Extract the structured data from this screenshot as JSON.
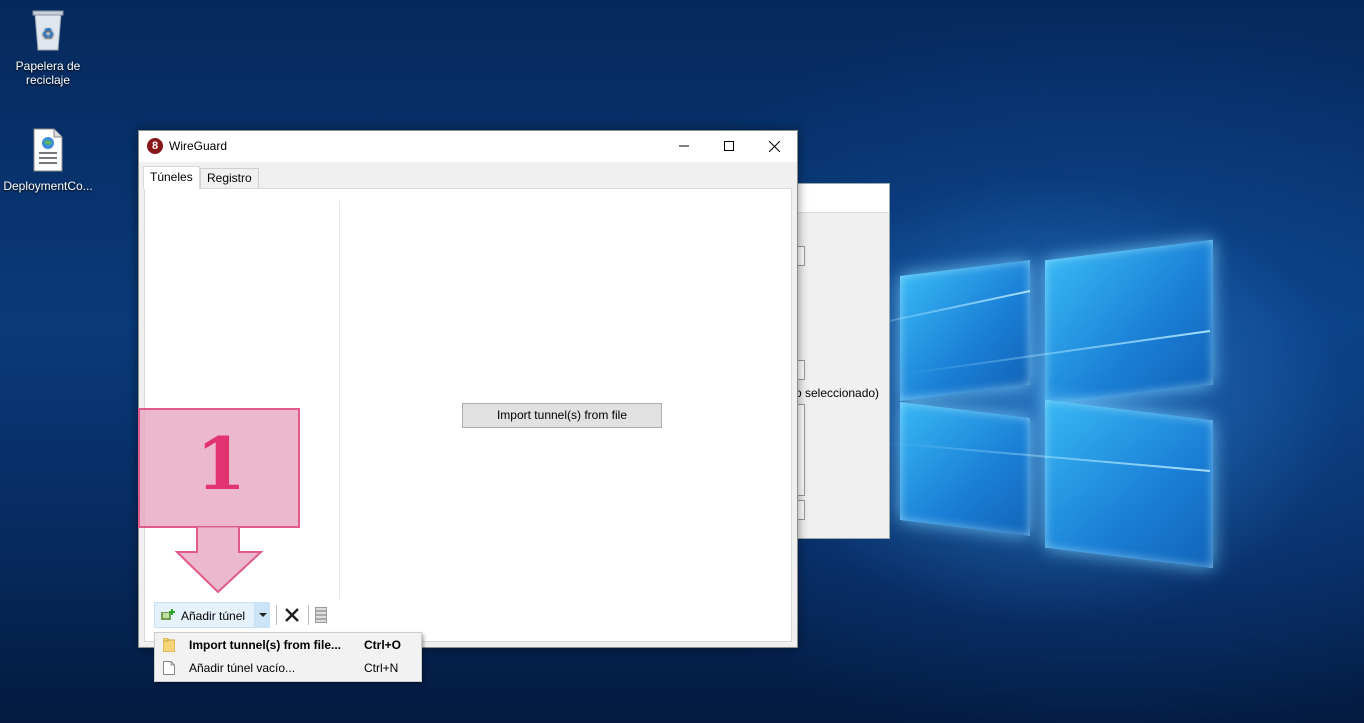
{
  "desktop": {
    "icons": [
      {
        "name": "recycle-bin",
        "label": "Papelera de reciclaje"
      },
      {
        "name": "deployment-file",
        "label": "DeploymentCo..."
      }
    ],
    "background_window": {
      "partial_text": "o seleccionado)"
    }
  },
  "window": {
    "title": "WireGuard",
    "caption_buttons": [
      "minimize",
      "maximize",
      "close"
    ],
    "tabs": [
      {
        "label": "Túneles",
        "active": true
      },
      {
        "label": "Registro",
        "active": false
      }
    ],
    "center_button": "Import tunnel(s) from file",
    "toolbar": {
      "add_label": "Añadir túnel",
      "delete_icon": "x-icon",
      "export_icon": "zip-icon"
    }
  },
  "dropdown_menu": {
    "items": [
      {
        "label": "Import tunnel(s) from file...",
        "shortcut": "Ctrl+O",
        "icon": "folder-icon",
        "bold": true
      },
      {
        "label": "Añadir túnel vacío...",
        "shortcut": "Ctrl+N",
        "icon": "document-icon",
        "bold": false
      }
    ]
  },
  "annotation": {
    "step_number": "1",
    "color": "#e0336f"
  }
}
